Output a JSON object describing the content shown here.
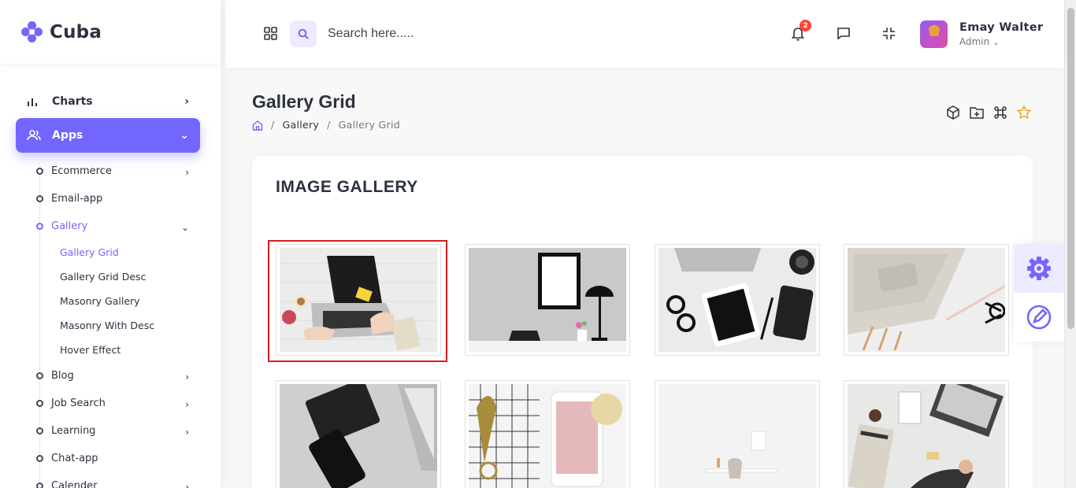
{
  "brand": {
    "name": "Cuba",
    "accent": "#7366ff"
  },
  "sidebar": {
    "top_items": [
      {
        "label": "Charts",
        "icon": "bar-chart-icon"
      },
      {
        "label": "Apps",
        "icon": "users-icon",
        "active": true
      }
    ],
    "apps_items": [
      {
        "label": "Ecommerce",
        "has_children": true
      },
      {
        "label": "Email-app",
        "has_children": false
      },
      {
        "label": "Gallery",
        "has_children": true,
        "expanded": true,
        "active": true
      },
      {
        "label": "Blog",
        "has_children": true
      },
      {
        "label": "Job Search",
        "has_children": true
      },
      {
        "label": "Learning",
        "has_children": true
      },
      {
        "label": "Chat-app",
        "has_children": false
      },
      {
        "label": "Calender",
        "has_children": true
      }
    ],
    "gallery_items": [
      {
        "label": "Gallery Grid",
        "active": true
      },
      {
        "label": "Gallery Grid Desc"
      },
      {
        "label": "Masonry Gallery"
      },
      {
        "label": "Masonry With Desc"
      },
      {
        "label": "Hover Effect"
      }
    ]
  },
  "header": {
    "search_placeholder": "Search here.....",
    "notifications_count": "2",
    "user_name": "Emay Walter",
    "user_role": "Admin"
  },
  "page": {
    "title": "Gallery Grid",
    "breadcrumb": [
      "Gallery",
      "Gallery Grid"
    ],
    "card_title": "IMAGE GALLERY"
  },
  "gallery": {
    "images": [
      {
        "subject": "laptop on white wood desk",
        "selected": true
      },
      {
        "subject": "blank frame, lamp and laptop on shelf"
      },
      {
        "subject": "laptop, tablet, glasses and camera"
      },
      {
        "subject": "laptop, pencils and scissors"
      },
      {
        "subject": "notebook, phone and laptop"
      },
      {
        "subject": "phone, grid paper and scissors"
      },
      {
        "subject": "white chair and desk"
      },
      {
        "subject": "business desk top view"
      }
    ]
  }
}
